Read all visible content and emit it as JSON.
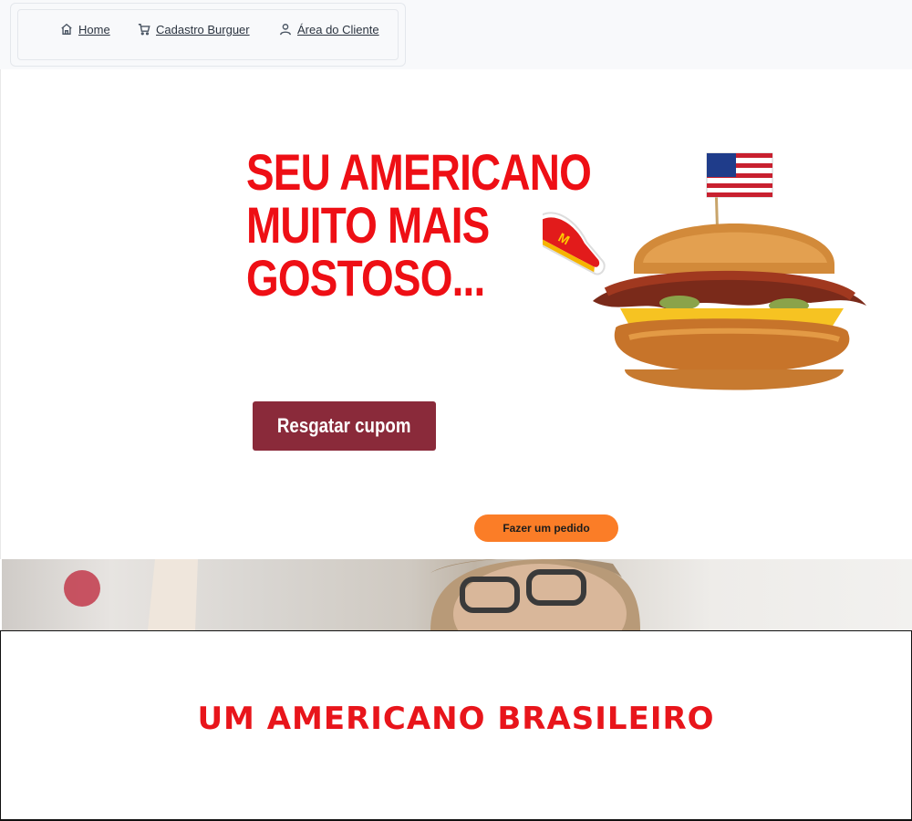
{
  "nav": {
    "items": [
      {
        "label": "Home",
        "icon": "home-icon"
      },
      {
        "label": "Cadastro Burguer",
        "icon": "cart-icon"
      },
      {
        "label": "Área do Cliente",
        "icon": "user-icon"
      }
    ]
  },
  "hero": {
    "headline_lines": [
      "SEU AMERICANO",
      "MUITO MAIS",
      "GOSTOSO..."
    ],
    "coupon_button": "Resgatar cupom",
    "order_button": "Fazer um pedido"
  },
  "banner": {
    "title": "UM AMERICANO BRASILEIRO"
  },
  "colors": {
    "headline_red": "#ee0f15",
    "coupon_button_bg": "#8a2a3a",
    "order_button_bg": "#fb7d27",
    "banner_title_red": "#e8151b"
  }
}
